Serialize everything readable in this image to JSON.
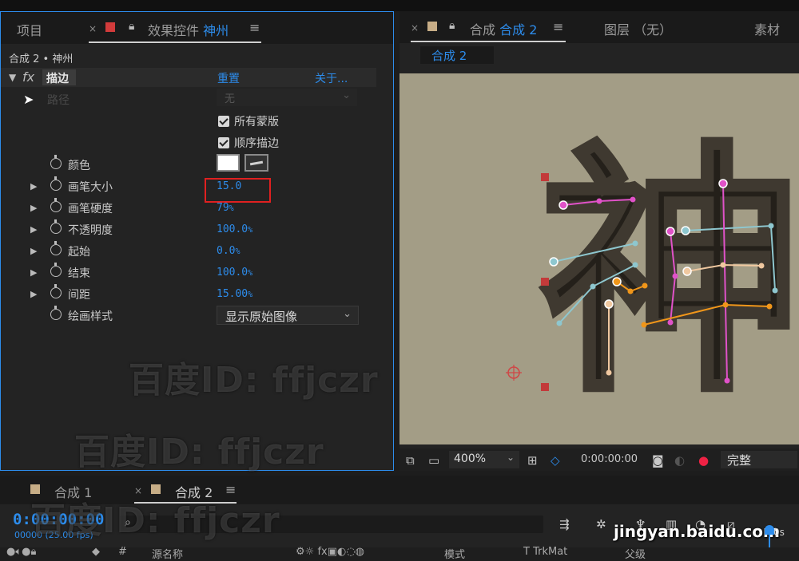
{
  "left_panel": {
    "tab_project": "项目",
    "tab_effect_controls": "效果控件",
    "tab_effect_layer": "神州",
    "breadcrumb": "合成 2 • 神州",
    "effect": {
      "fx_symbol": "fx",
      "name": "描边",
      "reset": "重置",
      "about": "关于..."
    },
    "path": {
      "label": "路径",
      "value": "无"
    },
    "all_masks": "所有蒙版",
    "sequential_stroke": "顺序描边",
    "properties": [
      {
        "label": "颜色"
      },
      {
        "label": "画笔大小",
        "value": "15.0",
        "unit": ""
      },
      {
        "label": "画笔硬度",
        "value": "79",
        "unit": "%"
      },
      {
        "label": "不透明度",
        "value": "100.0",
        "unit": "%"
      },
      {
        "label": "起始",
        "value": "0.0",
        "unit": "%"
      },
      {
        "label": "结束",
        "value": "100.0",
        "unit": "%"
      },
      {
        "label": "间距",
        "value": "15.00",
        "unit": "%"
      },
      {
        "label": "绘画样式"
      }
    ],
    "paint_style_value": "显示原始图像",
    "color_value": "#ffffff"
  },
  "right_panel": {
    "tab_comp": "合成",
    "tab_comp_name": "合成 2",
    "tab_layer": "图层 （无）",
    "tab_footage": "素材",
    "comp_chip": "合成 2",
    "zoom": "400%",
    "timecode": "0:00:00:00",
    "quality": "完整",
    "glyph_char": "神"
  },
  "timeline": {
    "tab1": "合成 1",
    "tab2": "合成 2",
    "current_time": "0:00:00:00",
    "fps": "00000 (25.00 fps)",
    "ruler_0s": "0s",
    "header_source_name": "源名称",
    "header_mode": "模式",
    "header_trkmat": "T TrkMat",
    "header_parent": "父级"
  },
  "watermarks": [
    "百度ID: ffjczr",
    "百度ID: ffjczr",
    "百度ID: ffjczr"
  ],
  "site_watermark": "jingyan.baidu.com",
  "colors": {
    "accent_blue": "#2d8ceb",
    "highlight_red": "#e02020",
    "comp_bg": "#a39d86"
  }
}
